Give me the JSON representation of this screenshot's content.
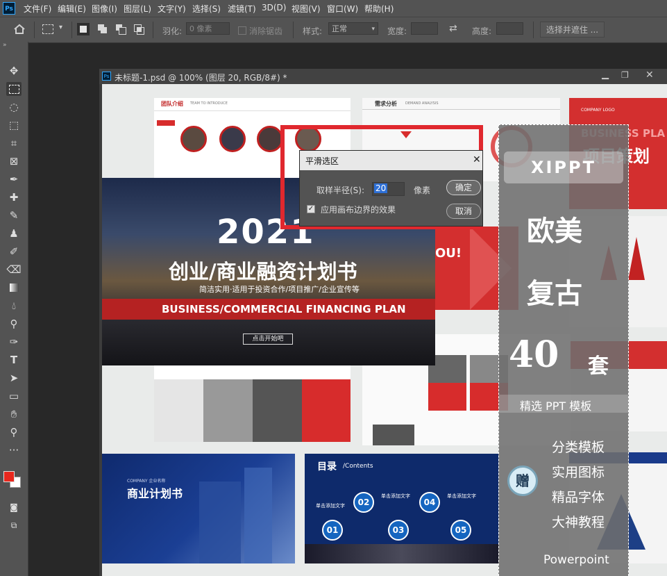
{
  "app": {
    "logo": "Ps"
  },
  "menu": [
    "文件(F)",
    "编辑(E)",
    "图像(I)",
    "图层(L)",
    "文字(Y)",
    "选择(S)",
    "滤镜(T)",
    "3D(D)",
    "视图(V)",
    "窗口(W)",
    "帮助(H)"
  ],
  "options": {
    "feather_label": "羽化:",
    "feather_value": "0 像素",
    "antialias_label": "消除锯齿",
    "style_label": "样式:",
    "style_value": "正常",
    "width_label": "宽度:",
    "height_label": "高度:",
    "select_mask_label": "选择并遮住 ..."
  },
  "document": {
    "title": "未标题-1.psd @ 100% (图层 20, RGB/8#) *"
  },
  "dialog": {
    "title": "平滑选区",
    "radius_label": "取样半径(S):",
    "radius_value": "20",
    "unit": "像素",
    "checkbox_label": "应用画布边界的效果",
    "checkbox_checked": true,
    "ok_label": "确定",
    "cancel_label": "取消"
  },
  "canvas": {
    "slide_a": {
      "header": "团队介绍",
      "sub": "TEAM TO INTRODUCE"
    },
    "slide_b": {
      "header": "需求分析",
      "sub": "DEMAND ANALYSIS"
    },
    "hero": {
      "year": "2021",
      "title": "创业/商业融资计划书",
      "subtitle": "简洁实用·适用于投资合作/项目推广/企业宣传等",
      "banner": "BUSINESS/COMMERCIAL FINANCING PLAN",
      "button": "点击开始吧"
    },
    "thankyou": "OU!",
    "bp_title": "商业计划书",
    "bp_company": "COMPANY 企业名称",
    "toc_title": "目录",
    "toc_sub": "/Contents",
    "toc_nums": [
      "01",
      "02",
      "03",
      "04",
      "05"
    ],
    "toc_item": "单击添加文字",
    "promo": {
      "brand": "XIPPT",
      "line1": "欧美",
      "line2": "复古",
      "count": "40",
      "count_unit": "套",
      "tag": "精选 PPT 模板",
      "gift": "赠",
      "gifts": [
        "分类模板",
        "实用图标",
        "精品字体",
        "大神教程"
      ],
      "footer": "Powerpoint"
    },
    "right_slide": {
      "logo": "COMPANY LOGO",
      "title": "BUSINESS PLA",
      "cn": "项目策划"
    }
  },
  "colors": {
    "accent_red": "#d72c2c",
    "ps_blue": "#31a8ff",
    "navy": "#0e2a6b"
  }
}
